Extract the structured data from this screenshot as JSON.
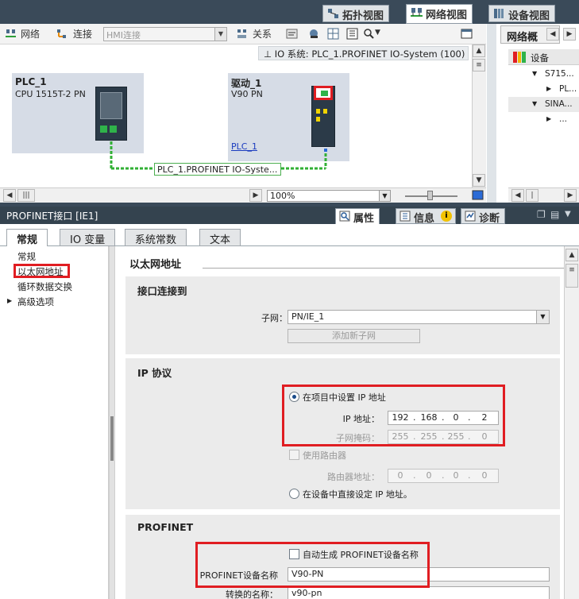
{
  "view_tabs": [
    {
      "label": "拓扑视图",
      "icon": "topology-view-icon"
    },
    {
      "label": "网络视图",
      "icon": "network-view-icon",
      "active": true
    },
    {
      "label": "设备视图",
      "icon": "device-view-icon"
    }
  ],
  "net_toolbar": {
    "network_label": "网络",
    "connect_label": "连接",
    "hmi_select_placeholder": "HMI连接",
    "relation_label": "关系"
  },
  "io_system_label": "IO 系统: PLC_1.PROFINET IO-System (100)",
  "devices": {
    "plc": {
      "name": "PLC_1",
      "type": "CPU 1515T-2 PN"
    },
    "drive": {
      "name": "驱动_1",
      "type": "V90 PN",
      "link": "PLC_1"
    }
  },
  "network_label": "PLC_1.PROFINET IO-Syste...",
  "zoom": "100%",
  "overview": {
    "tab_label": "网络概",
    "header": "设备",
    "rows": [
      "S715...",
      "PL...",
      "SINA...",
      "..."
    ]
  },
  "inspector": {
    "title": "PROFINET接口 [IE1]",
    "tabs": [
      {
        "label": "属性",
        "icon": "properties-icon",
        "active": true
      },
      {
        "label": "信息",
        "icon": "info-icon"
      },
      {
        "label": "诊断",
        "icon": "diagnostics-icon"
      }
    ],
    "subtabs": [
      {
        "label": "常规",
        "active": true
      },
      {
        "label": "IO 变量"
      },
      {
        "label": "系统常数"
      },
      {
        "label": "文本"
      }
    ],
    "nav": [
      "常规",
      "以太网地址",
      "循环数据交换",
      "高级选项"
    ],
    "section_title": "以太网地址",
    "group_interface": {
      "title": "接口连接到",
      "subnet_label": "子网：",
      "subnet_value": "PN/IE_1",
      "add_subnet_button": "添加新子网"
    },
    "group_ip": {
      "title": "IP 协议",
      "set_in_project": "在项目中设置 IP 地址",
      "ip_label": "IP 地址：",
      "ip": [
        "192",
        "168",
        "0",
        "2"
      ],
      "mask_label": "子网掩码：",
      "mask": [
        "255",
        "255",
        "255",
        "0"
      ],
      "use_router": "使用路由器",
      "router_label": "路由器地址：",
      "router": [
        "0",
        "0",
        "0",
        "0"
      ],
      "set_on_device": "在设备中直接设定 IP 地址。"
    },
    "group_profinet": {
      "title": "PROFINET",
      "auto_name": "自动生成 PROFINET设备名称",
      "device_name_label": "PROFINET设备名称",
      "device_name": "V90-PN",
      "converted_label": "转换的名称：",
      "converted_name": "v90-pn"
    }
  },
  "colors": {
    "highlight": "#e01d22",
    "network_line": "#31b034",
    "header_bg": "#34434f"
  }
}
